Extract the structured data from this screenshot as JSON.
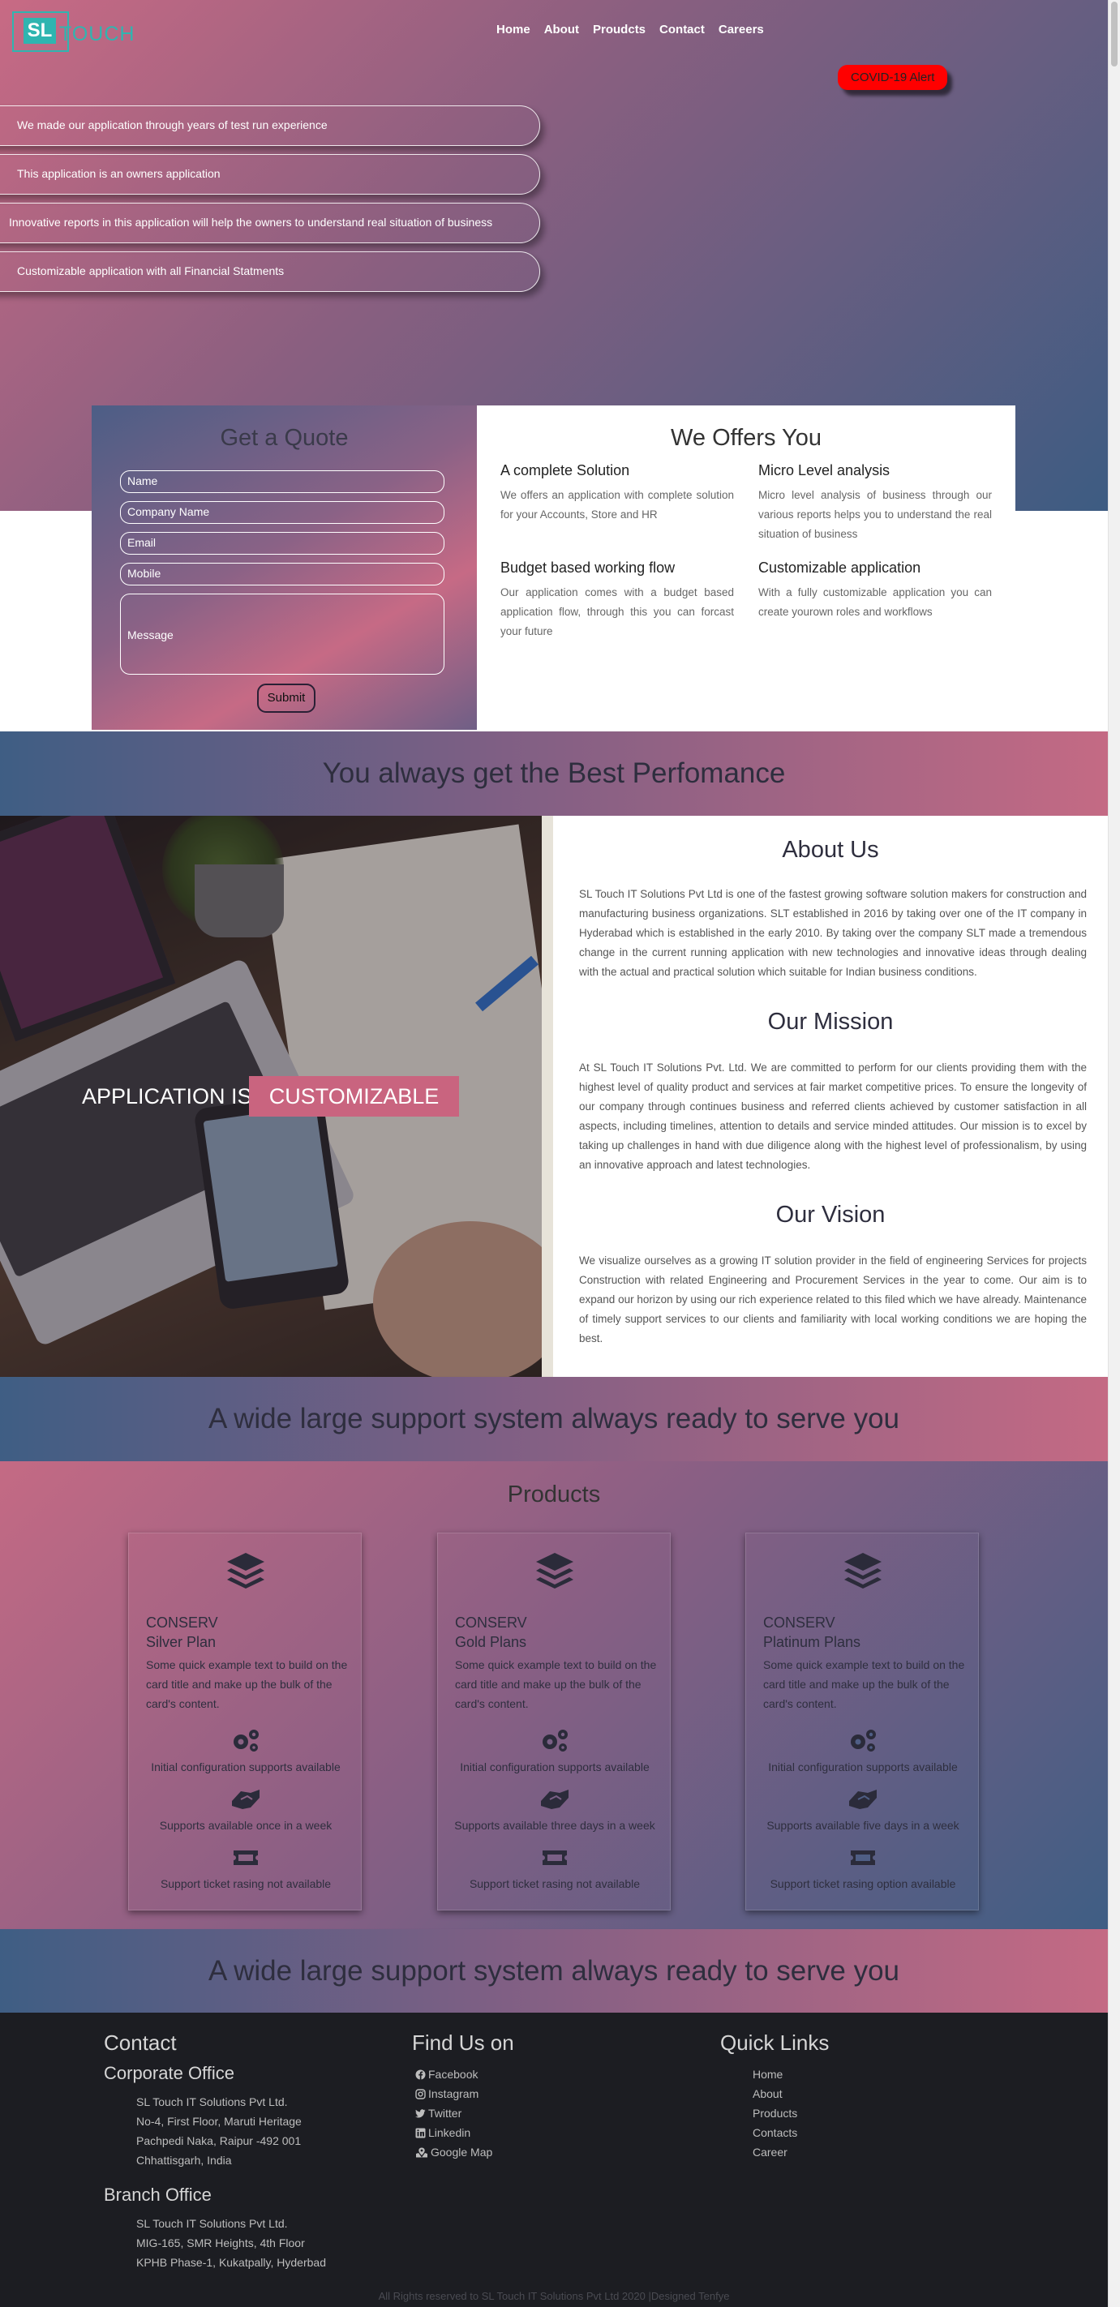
{
  "logo": {
    "short": "SL",
    "name": "TOUCH"
  },
  "nav": {
    "items": [
      "Home",
      "About",
      "Proudcts",
      "Contact",
      "Careers"
    ]
  },
  "alert": {
    "label": "COVID-19 Alert"
  },
  "hero": {
    "bullets": [
      "We made our application through years of test run experience",
      "This application is an owners application",
      "Innovative reports in this application will help the owners to understand real situation of business",
      "Customizable application with all Financial Statments"
    ]
  },
  "quote": {
    "title": "Get a Quote",
    "placeholders": {
      "name": "Name",
      "company": "Company Name",
      "email": "Email",
      "mobile": "Mobile",
      "message": "Message"
    },
    "submit": "Submit"
  },
  "offers": {
    "title": "We Offers You",
    "items": [
      {
        "title": "A complete Solution",
        "text": "We offers an application with complete solution for your Accounts, Store and HR"
      },
      {
        "title": "Micro Level analysis",
        "text": "Micro level analysis of business through our various reports helps you to understand the real situation of business"
      },
      {
        "title": "Budget based working flow",
        "text": "Our application comes with a budget based application flow, through this you can forcast your future"
      },
      {
        "title": "Customizable application",
        "text": "With a fully customizable application you can create yourown roles and workflows"
      }
    ]
  },
  "bands": {
    "performance": "You always get the Best Perfomance",
    "support1": "A wide large support system always ready to serve you",
    "support2": "A wide large support system always ready to serve you"
  },
  "photo": {
    "caption_a": "APPLICATION IS",
    "caption_b": "CUSTOMIZABLE"
  },
  "about": {
    "title": "About Us",
    "text": "SL Touch IT Solutions Pvt Ltd is one of the fastest growing software solution makers for construction and manufacturing business organizations. SLT established in 2016 by taking over one of the IT company in Hyderabad which is established in the early 2010. By taking over the company SLT made a tremendous change in the current running application with new technologies and innovative ideas through dealing with the actual and practical solution which suitable for Indian business conditions.",
    "mission_title": "Our Mission",
    "mission_text": "At SL Touch IT Solutions Pvt. Ltd. We are committed to perform for our clients providing them with the highest level of quality product and services at fair market competitive prices. To ensure the longevity of our company through continues business and referred clients achieved by customer satisfaction in all aspects, including timelines, attention to details and service minded attitudes. Our mission is to excel by taking up challenges in hand with due diligence along with the highest level of professionalism, by using an innovative approach and latest technologies.",
    "vision_title": "Our Vision",
    "vision_text": "We visualize ourselves as a growing IT solution provider in the field of engineering Services for projects Construction with related Engineering and Procurement Services in the year to come. Our aim is to expand our horizon by using our rich experience related to this filed which we have already. Maintenance of timely support services to our clients and familiarity with local working conditions we are hoping the best."
  },
  "products": {
    "title": "Products",
    "cards": [
      {
        "brand": "CONSERV",
        "plan": "Silver Plan",
        "desc": "Some quick example text to build on the card title and make up the bulk of the card's content.",
        "f1": "Initial configuration supports available",
        "f2": "Supports available once in a week",
        "f3": "Support ticket rasing not available"
      },
      {
        "brand": "CONSERV",
        "plan": "Gold Plans",
        "desc": "Some quick example text to build on the card title and make up the bulk of the card's content.",
        "f1": "Initial configuration supports available",
        "f2": "Supports available three days in a week",
        "f3": "Support ticket rasing not available"
      },
      {
        "brand": "CONSERV",
        "plan": "Platinum Plans",
        "desc": "Some quick example text to build on the card title and make up the bulk of the card's content.",
        "f1": "Initial configuration supports available",
        "f2": "Supports available five days in a week",
        "f3": "Support ticket rasing option available"
      }
    ]
  },
  "footer": {
    "contact_title": "Contact",
    "corporate_title": "Corporate Office",
    "corporate_lines": [
      "SL Touch IT Solutions Pvt Ltd.",
      "No-4, First Floor, Maruti Heritage",
      "Pachpedi Naka, Raipur -492 001",
      "Chhattisgarh, India"
    ],
    "branch_title": "Branch Office",
    "branch_lines": [
      "SL Touch IT Solutions Pvt Ltd.",
      "MIG-165, SMR Heights, 4th Floor",
      "KPHB Phase-1, Kukatpally, Hyderbad"
    ],
    "find_title": "Find Us on",
    "social": [
      "Facebook",
      "Instagram",
      "Twitter",
      "Linkedin",
      "Google Map"
    ],
    "quick_title": "Quick Links",
    "quick": [
      "Home",
      "About",
      "Products",
      "Contacts",
      "Career"
    ],
    "copyright": "All Rights reserved to SL Touch IT Solutions Pvt Ltd 2020 |Designed Tenfye"
  },
  "colors": {
    "accent_teal": "#2fb5b0",
    "alert_red": "#ff0000",
    "caption_pink": "#c9647f",
    "footer_bg": "#1c1d22"
  }
}
